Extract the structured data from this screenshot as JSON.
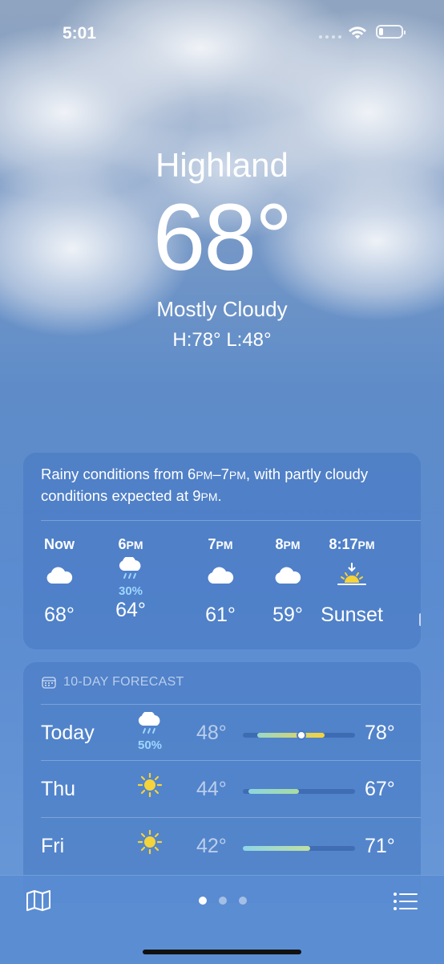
{
  "status_bar": {
    "time": "5:01"
  },
  "location": {
    "city": "Highland",
    "temperature": "68°",
    "condition": "Mostly Cloudy",
    "high_low": "H:78°  L:48°"
  },
  "hourly": {
    "summary": {
      "part1": "Rainy conditions from 6",
      "pm1": "PM",
      "part2": "–7",
      "pm2": "PM",
      "part3": ", with partly cloudy conditions expected at 9",
      "pm3": "PM",
      "part4": "."
    },
    "hours": [
      {
        "label": "Now",
        "suffix": "",
        "icon": "cloud-icon",
        "precip": "",
        "temp": "68°"
      },
      {
        "label": "6",
        "suffix": "PM",
        "icon": "rain-cloud-icon",
        "precip": "30%",
        "temp": "64°"
      },
      {
        "label": "7",
        "suffix": "PM",
        "icon": "cloud-icon",
        "precip": "",
        "temp": "61°"
      },
      {
        "label": "8",
        "suffix": "PM",
        "icon": "cloud-icon",
        "precip": "",
        "temp": "59°"
      },
      {
        "label": "8:17",
        "suffix": "PM",
        "icon": "sunset-icon",
        "precip": "",
        "temp": "Sunset"
      }
    ]
  },
  "daily": {
    "header": "10-DAY FORECAST",
    "days": [
      {
        "day": "Today",
        "icon": "rain-cloud-icon",
        "precip": "50%",
        "low": "48°",
        "high": "78°",
        "range_start": 0.13,
        "range_end": 0.73,
        "current": 0.52,
        "colors": [
          "#9ad8c8",
          "#f5d33a"
        ]
      },
      {
        "day": "Thu",
        "icon": "sun-icon",
        "precip": "",
        "low": "44°",
        "high": "67°",
        "range_start": 0.05,
        "range_end": 0.5,
        "colors": [
          "#8ed6e0",
          "#a8dca0"
        ]
      },
      {
        "day": "Fri",
        "icon": "sun-icon",
        "precip": "",
        "low": "42°",
        "high": "71°",
        "range_start": 0.0,
        "range_end": 0.6,
        "colors": [
          "#8ed6e8",
          "#c0e0a0"
        ]
      }
    ]
  },
  "tab_bar": {
    "page_count": 3,
    "active_page": 1
  }
}
